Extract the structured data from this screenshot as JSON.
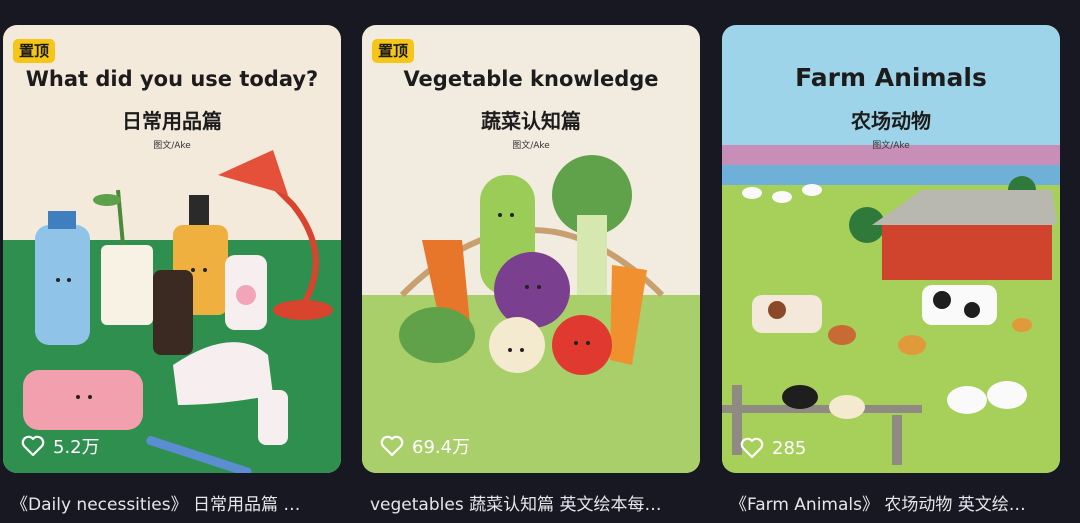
{
  "pin_label": "置顶",
  "cards": [
    {
      "cover_en": "What did you use today?",
      "cover_zh": "日常用品篇",
      "author": "图文/Ake",
      "likes": "5.2万",
      "caption": "《Daily necessities》 日常用品篇 …",
      "pinned": true
    },
    {
      "cover_en": "Vegetable knowledge",
      "cover_zh": "蔬菜认知篇",
      "author": "图文/Ake",
      "likes": "69.4万",
      "caption": "vegetables 蔬菜认知篇 英文绘本每…",
      "pinned": true
    },
    {
      "cover_en": "Farm Animals",
      "cover_zh": "农场动物",
      "author": "图文/Ake",
      "likes": "285",
      "caption": "《Farm Animals》 农场动物 英文绘…",
      "pinned": false
    }
  ],
  "icons": {
    "like": "heart-outline-icon"
  }
}
